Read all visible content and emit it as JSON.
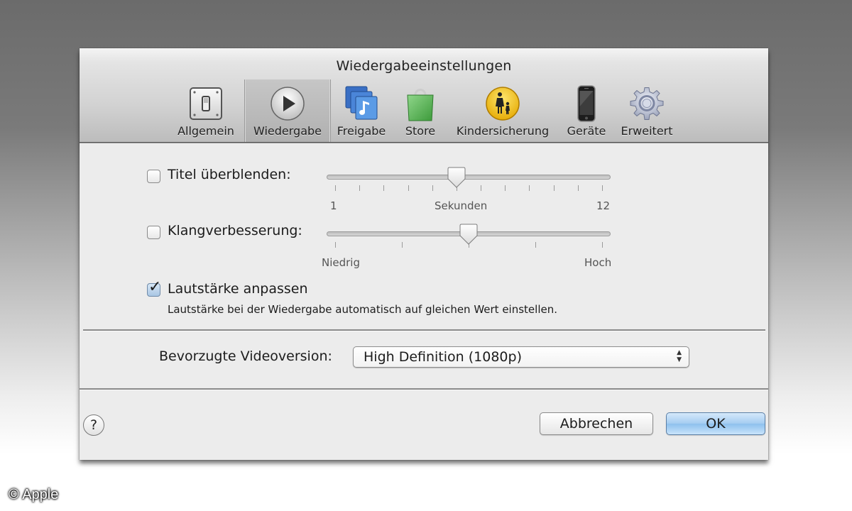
{
  "window": {
    "title": "Wiedergabeeinstellungen"
  },
  "toolbar": {
    "tabs": [
      {
        "label": "Allgemein",
        "icon": "switch-icon",
        "selected": false
      },
      {
        "label": "Wiedergabe",
        "icon": "play-icon",
        "selected": true
      },
      {
        "label": "Freigabe",
        "icon": "shared-music-icon",
        "selected": false
      },
      {
        "label": "Store",
        "icon": "shopping-bag-icon",
        "selected": false
      },
      {
        "label": "Kindersicherung",
        "icon": "parental-control-icon",
        "selected": false
      },
      {
        "label": "Geräte",
        "icon": "iphone-icon",
        "selected": false
      },
      {
        "label": "Erweitert",
        "icon": "gear-icon",
        "selected": false
      }
    ]
  },
  "crossfade": {
    "label": "Titel überblenden:",
    "checked": false,
    "slider": {
      "min": 1,
      "max": 12,
      "value": 6,
      "tick_count": 12
    },
    "min_label": "1",
    "unit_label": "Sekunden",
    "max_label": "12"
  },
  "sound_enhancer": {
    "label": "Klangverbesserung:",
    "checked": false,
    "slider": {
      "min": 0,
      "max": 4,
      "value": 2,
      "tick_count": 5
    },
    "min_label": "Niedrig",
    "max_label": "Hoch"
  },
  "sound_check": {
    "label": "Lautstärke anpassen",
    "checked": true,
    "description": "Lautstärke bei der Wiedergabe automatisch auf gleichen Wert einstellen."
  },
  "video_version": {
    "label": "Bevorzugte Videoversion:",
    "selected": "High Definition (1080p)"
  },
  "footer": {
    "help_label": "?",
    "cancel_label": "Abbrechen",
    "ok_label": "OK"
  },
  "watermark": {
    "text": "© Apple"
  },
  "colors": {
    "default_button": "#a6cdf1",
    "parental_yellow": "#f3c417",
    "store_green": "#5cb85c",
    "freigabe_blue": "#3b7fd6"
  }
}
